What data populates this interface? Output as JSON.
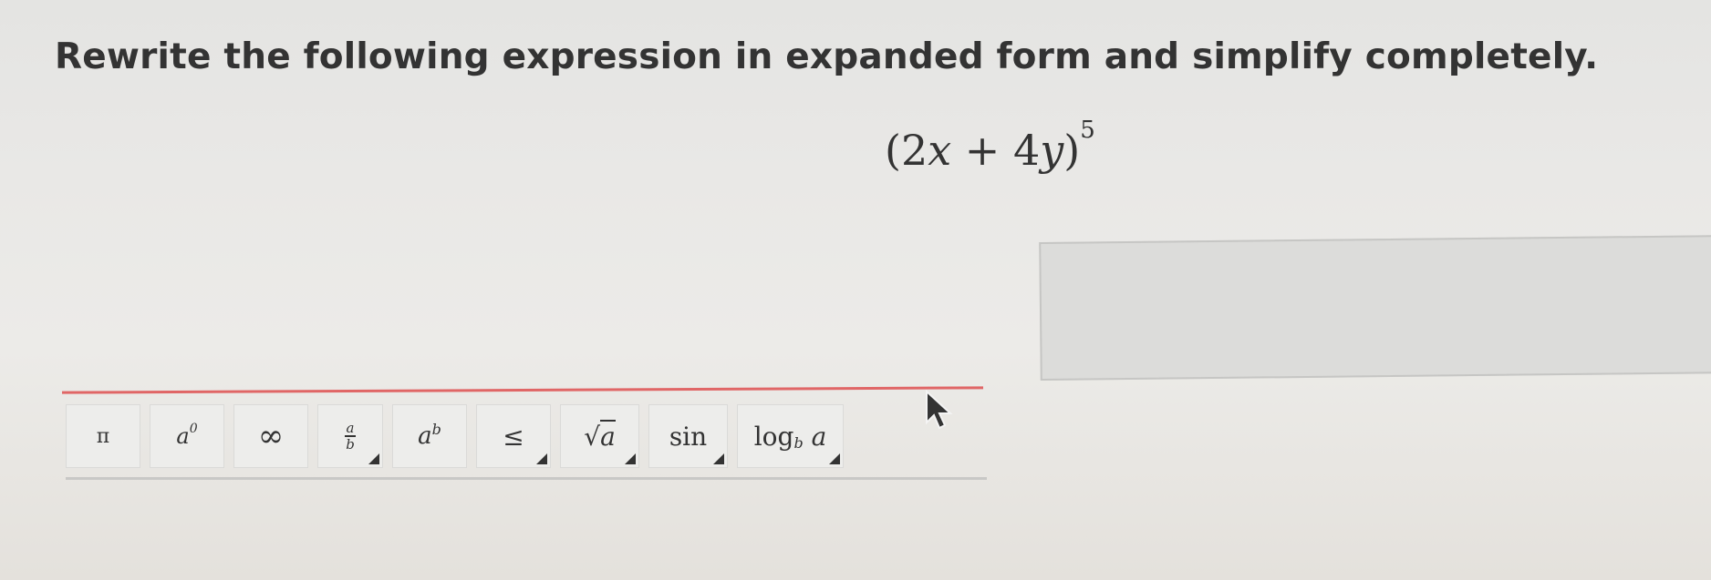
{
  "question": {
    "instruction": "Rewrite the following expression in expanded form and simplify completely.",
    "expression": {
      "open": "(2",
      "x": "x",
      "plus": " + 4",
      "y": "y",
      "close": ")",
      "exponent": "5"
    }
  },
  "answer": {
    "value": ""
  },
  "toolbar": {
    "buttons": [
      {
        "name": "pi",
        "label": "π"
      },
      {
        "name": "a-superscript-zero",
        "base": "a",
        "sup": "0"
      },
      {
        "name": "infinity",
        "label": "∞"
      },
      {
        "name": "fraction",
        "num": "a",
        "den": "b"
      },
      {
        "name": "power",
        "base": "a",
        "sup": "b"
      },
      {
        "name": "less-equal",
        "label": "≤"
      },
      {
        "name": "square-root",
        "radical": "√",
        "arg": "a"
      },
      {
        "name": "sin",
        "label": "sin"
      },
      {
        "name": "log",
        "label": "log",
        "sub": "b",
        "arg": "a"
      }
    ]
  },
  "colors": {
    "toolbar_accent": "#e06666",
    "background": "#e9e8e6"
  }
}
